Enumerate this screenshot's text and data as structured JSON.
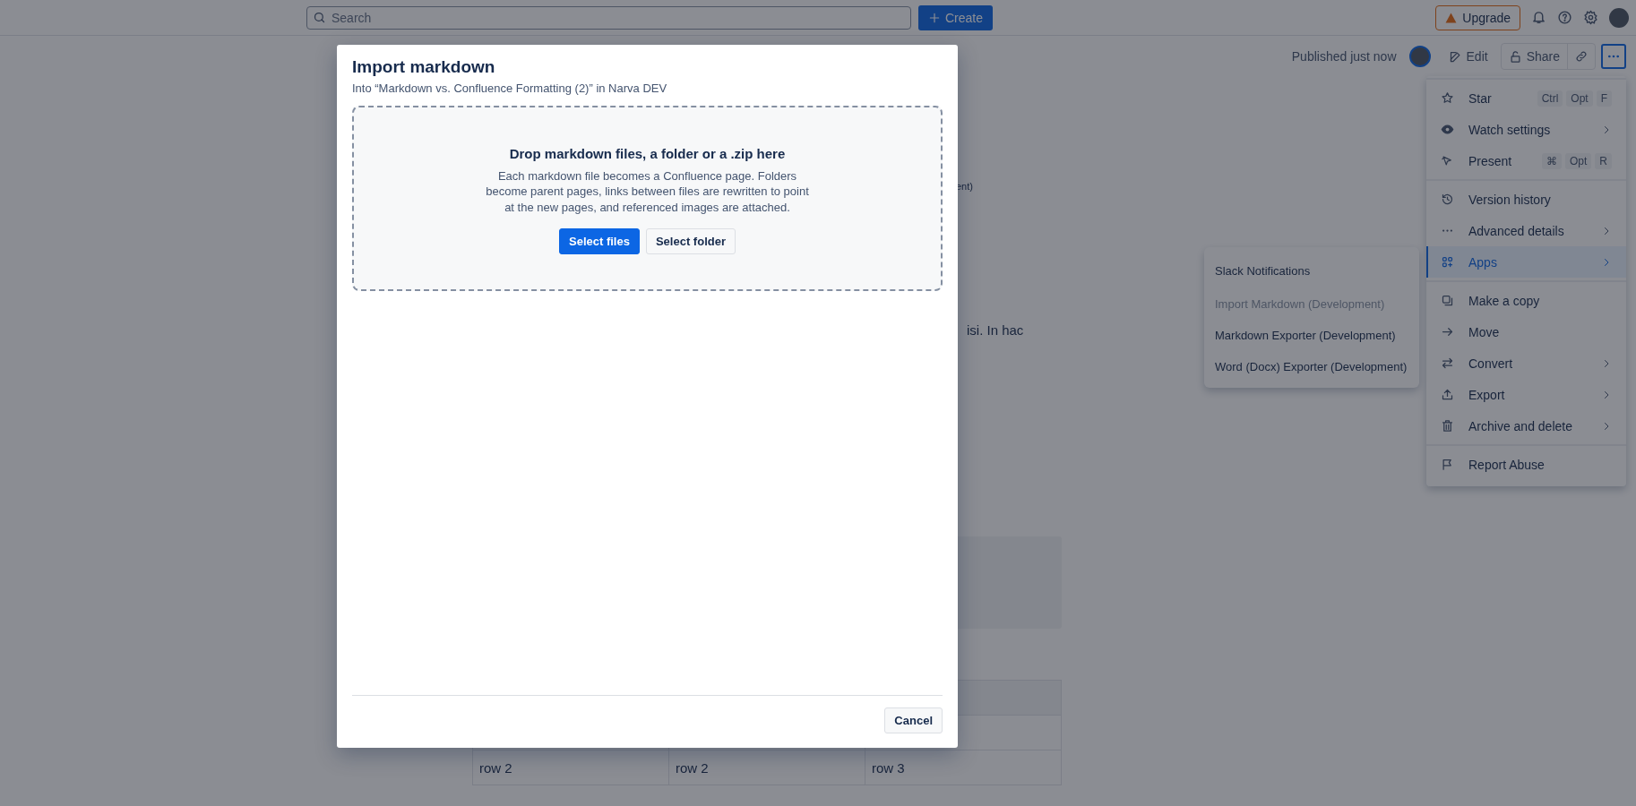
{
  "top_bar": {
    "search": {
      "placeholder": "Search"
    },
    "create_button": "Create",
    "upgrade_button": "Upgrade"
  },
  "page_header": {
    "status": "Published just now",
    "edit_button": "Edit",
    "share_button": "Share"
  },
  "page_content": {
    "text_fragments": [
      "ent)",
      "isi. In hac"
    ],
    "table": {
      "rows": [
        [
          "row 2",
          "row 2",
          "row 3"
        ]
      ]
    }
  },
  "more_menu": {
    "groups": [
      {
        "items": [
          {
            "label": "Star",
            "keys": [
              "Ctrl",
              "Opt",
              "F"
            ],
            "submenu": false,
            "selected": false
          },
          {
            "label": "Watch settings",
            "submenu": true,
            "selected": false
          },
          {
            "label": "Present",
            "keys": [
              "⌘",
              "Opt",
              "R"
            ],
            "submenu": false,
            "selected": false
          }
        ]
      },
      {
        "items": [
          {
            "label": "Version history",
            "submenu": false,
            "selected": false
          },
          {
            "label": "Advanced details",
            "submenu": true,
            "selected": false
          },
          {
            "label": "Apps",
            "submenu": true,
            "selected": true
          }
        ]
      },
      {
        "items": [
          {
            "label": "Make a copy",
            "submenu": false,
            "selected": false
          },
          {
            "label": "Move",
            "submenu": false,
            "selected": false
          },
          {
            "label": "Convert",
            "submenu": true,
            "selected": false
          },
          {
            "label": "Export",
            "submenu": true,
            "selected": false
          },
          {
            "label": "Archive and delete",
            "submenu": true,
            "selected": false
          }
        ]
      },
      {
        "items": [
          {
            "label": "Report Abuse",
            "submenu": false,
            "selected": false
          }
        ]
      }
    ]
  },
  "apps_submenu": {
    "items": [
      {
        "label": "Slack Notifications",
        "disabled": false
      },
      {
        "label": "Import Markdown (Development)",
        "disabled": true
      },
      {
        "label": "Markdown Exporter (Development)",
        "disabled": false
      },
      {
        "label": "Word (Docx) Exporter (Development)",
        "disabled": false
      }
    ]
  },
  "modal": {
    "title": "Import markdown",
    "subtitle": "Into “Markdown vs. Confluence Formatting (2)” in Narva DEV",
    "drop_zone": {
      "heading": "Drop markdown files, a folder or a .zip here",
      "description": "Each markdown file becomes a Confluence page. Folders become parent pages, links between files are rewritten to point at the new pages, and referenced images are attached.",
      "buttons": [
        {
          "label": "Select files",
          "primary": true
        },
        {
          "label": "Select folder",
          "primary": false
        }
      ]
    },
    "cancel_button": "Cancel"
  }
}
